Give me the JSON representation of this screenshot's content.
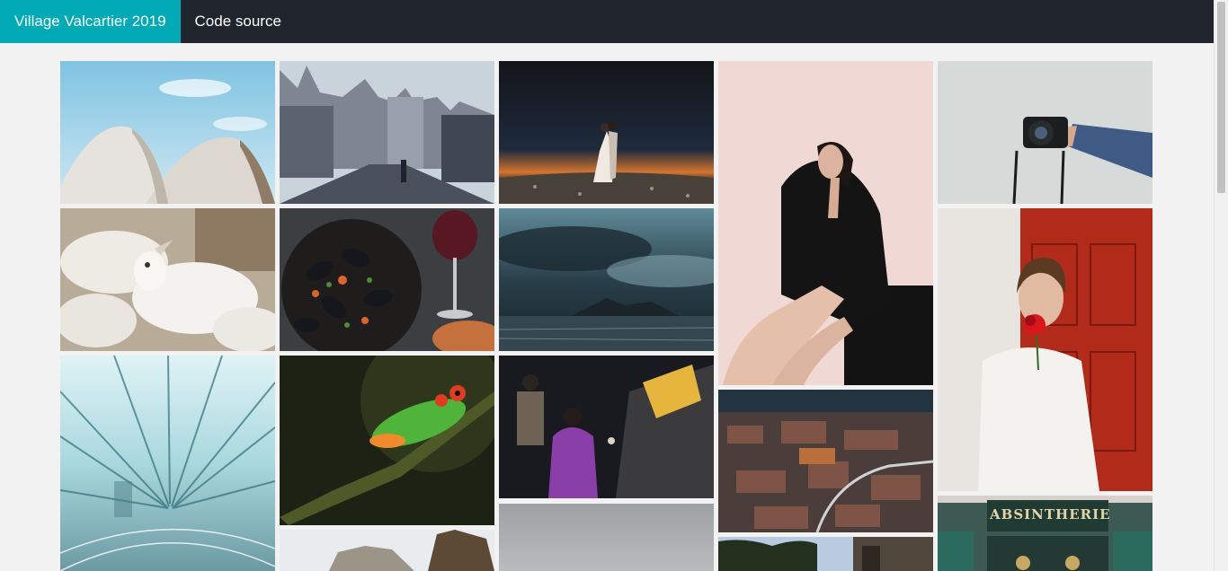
{
  "nav": {
    "brand": "Village Valcartier 2019",
    "source_link": "Code source"
  },
  "colors": {
    "navbar": "#20242d",
    "brand_accent": "#00aab7",
    "page_background": "#f2f2f2"
  },
  "gallery": {
    "photos": [
      {
        "name": "photo-opera-house",
        "subject": "white sail roof under blue sky"
      },
      {
        "name": "photo-gothic-street",
        "subject": "gothic cathedral street"
      },
      {
        "name": "photo-couple-sunset",
        "subject": "couple embracing at dusk"
      },
      {
        "name": "photo-woman-black-dress",
        "subject": "seated woman in black"
      },
      {
        "name": "photo-hand-camera",
        "subject": "arm holding a camera"
      },
      {
        "name": "photo-white-goats",
        "subject": "herd of white goats"
      },
      {
        "name": "photo-mussels-wine",
        "subject": "mussels and wine on table"
      },
      {
        "name": "photo-stormy-sea",
        "subject": "stormy clouds over sea"
      },
      {
        "name": "photo-man-red-door",
        "subject": "man with rose by red door"
      },
      {
        "name": "photo-speed-tunnel",
        "subject": "motion-blur tunnel"
      },
      {
        "name": "photo-tree-frog",
        "subject": "red-eyed tree frog on branch"
      },
      {
        "name": "photo-night-ritual",
        "subject": "people at night ritual"
      },
      {
        "name": "photo-aerial-city",
        "subject": "dense hillside city"
      },
      {
        "name": "photo-rocky-cliff",
        "subject": "rock cliff and pine"
      },
      {
        "name": "photo-grey-sky",
        "subject": "grey overcast sky"
      },
      {
        "name": "photo-forest-edge",
        "subject": "trees and building"
      },
      {
        "name": "photo-absinthe-shop",
        "subject": "shop front sign"
      }
    ],
    "shop_sign_text": "ABSINTHERIE"
  }
}
